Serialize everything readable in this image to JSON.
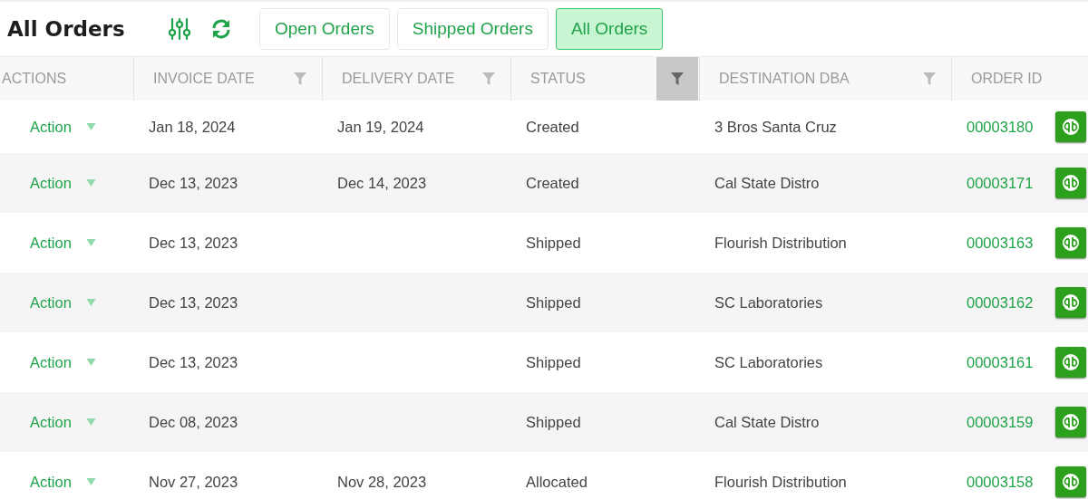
{
  "title": "All Orders",
  "tabs": [
    {
      "label": "Open Orders",
      "selected": false
    },
    {
      "label": "Shipped Orders",
      "selected": false
    },
    {
      "label": "All Orders",
      "selected": true
    }
  ],
  "table": {
    "columns": [
      {
        "label": "ACTIONS",
        "filter": false
      },
      {
        "label": "INVOICE DATE",
        "filter": true,
        "filter_active": false
      },
      {
        "label": "DELIVERY DATE",
        "filter": true,
        "filter_active": false
      },
      {
        "label": "STATUS",
        "filter": true,
        "filter_active": true
      },
      {
        "label": "DESTINATION DBA",
        "filter": true,
        "filter_active": false
      },
      {
        "label": "ORDER ID",
        "filter": false
      }
    ],
    "rows": [
      {
        "action": "Action",
        "invoice_date": "Jan 18, 2024",
        "delivery_date": "Jan 19, 2024",
        "status": "Created",
        "destination": "3 Bros Santa Cruz",
        "order_id": "00003180"
      },
      {
        "action": "Action",
        "invoice_date": "Dec 13, 2023",
        "delivery_date": "Dec 14, 2023",
        "status": "Created",
        "destination": "Cal State Distro",
        "order_id": "00003171"
      },
      {
        "action": "Action",
        "invoice_date": "Dec 13, 2023",
        "status": "Shipped",
        "destination": "Flourish Distribution",
        "order_id": "00003163"
      },
      {
        "action": "Action",
        "invoice_date": "Dec 13, 2023",
        "status": "Shipped",
        "destination": "SC Laboratories",
        "order_id": "00003162"
      },
      {
        "action": "Action",
        "invoice_date": "Dec 13, 2023",
        "status": "Shipped",
        "destination": "SC Laboratories",
        "order_id": "00003161"
      },
      {
        "action": "Action",
        "invoice_date": "Dec 08, 2023",
        "status": "Shipped",
        "destination": "Cal State Distro",
        "order_id": "00003159"
      },
      {
        "action": "Action",
        "invoice_date": "Nov 27, 2023",
        "delivery_date": "Nov 28, 2023",
        "status": "Allocated",
        "destination": "Flourish Distribution",
        "order_id": "00003158"
      }
    ]
  }
}
